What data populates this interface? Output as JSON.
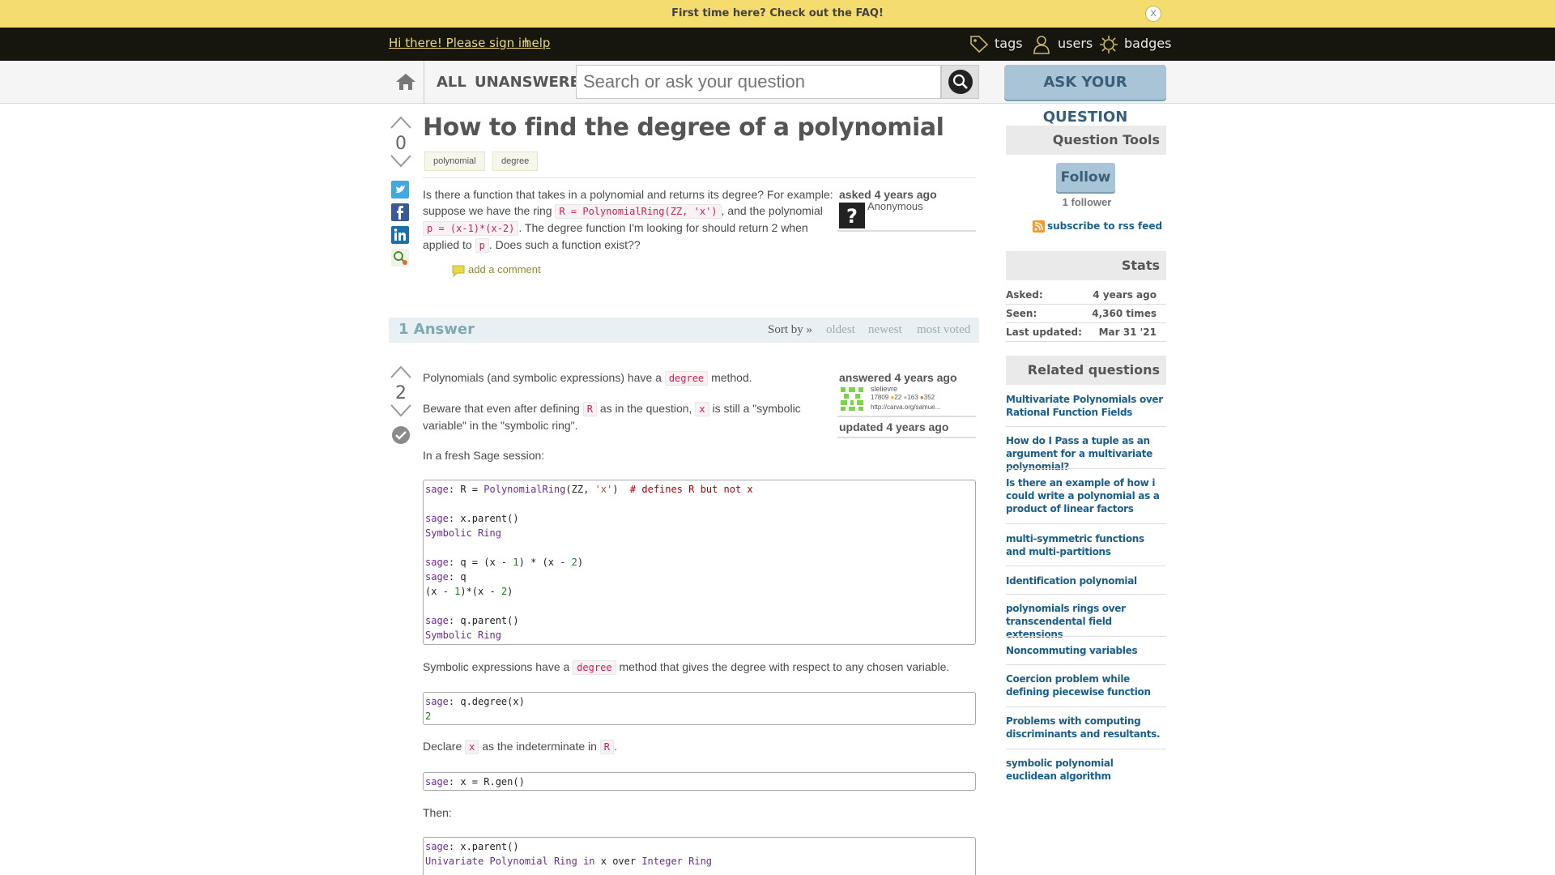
{
  "notify": {
    "message": "First time here? Check out the FAQ!",
    "close": "X"
  },
  "header": {
    "signin": "Hi there! Please sign in",
    "help": "help",
    "nav": [
      {
        "label": "tags",
        "icon": "tag-icon"
      },
      {
        "label": "users",
        "icon": "user-icon"
      },
      {
        "label": "badges",
        "icon": "badge-icon"
      }
    ]
  },
  "secbar": {
    "scope_all": "ALL",
    "scope_unanswered": "UNANSWERED",
    "search_placeholder": "Search or ask your question",
    "ask_button": "ASK YOUR QUESTION"
  },
  "question": {
    "title": "How to find the degree of a polynomial",
    "votes": "0",
    "tags": [
      "polynomial",
      "degree"
    ],
    "text1": "Is there a function that takes in a polynomial and returns its degree? For example: suppose we have the ring",
    "code1": "R = PolynomialRing(ZZ, 'x')",
    "text2": ", and the polynomial",
    "code2": "p = (x-1)*(x-2)",
    "text3": ". The degree function I'm looking for should return 2 when applied to",
    "code3": "p",
    "text4": ". Does such a function exist??",
    "asked": "asked 4 years ago",
    "author": "Anonymous",
    "add_comment": "add a comment"
  },
  "answers": {
    "count": "1 Answer",
    "sort_by": "Sort by »",
    "sort_oldest": "oldest",
    "sort_newest": "newest",
    "sort_most_voted": "most voted"
  },
  "answer": {
    "votes": "2",
    "answered": "answered 4 years ago",
    "user": "slelievre",
    "karma": "17809",
    "badge1": "22",
    "badge2": "163",
    "badge3": "352",
    "url": "http://carva.org/samue...",
    "updated": "updated 4 years ago",
    "p1a": "Polynomials (and symbolic expressions) have a",
    "p1code": "degree",
    "p1b": "method.",
    "p2a": "Beware that even after defining",
    "p2code1": "R",
    "p2b": "as in the question,",
    "p2code2": "x",
    "p2c": "is still a \"symbolic variable\" in the \"symbolic ring\".",
    "p3": "In a fresh Sage session:",
    "p4a": "Symbolic expressions have a",
    "p4code": "degree",
    "p4b": "method that gives the degree with respect to any chosen variable.",
    "p5a": "Declare",
    "p5code1": "x",
    "p5b": "as the indeterminate in",
    "p5code2": "R",
    "p5c": ".",
    "p6": "Then:"
  },
  "sidebar": {
    "tools_title": "Question Tools",
    "follow": "Follow",
    "followers": "1 follower",
    "rss": "subscribe to rss feed",
    "stats_title": "Stats",
    "stats": [
      {
        "label": "Asked:",
        "value": "4 years ago"
      },
      {
        "label": "Seen:",
        "value": "4,360 times"
      },
      {
        "label": "Last updated:",
        "value": "Mar 31 '21"
      }
    ],
    "related_title": "Related questions",
    "related": [
      "Multivariate Polynomials over Rational Function Fields",
      "How do I Pass a tuple as an argument for a multivariate polynomial?",
      "Is there an example of how i could write a polynomial as a product of linear factors",
      "multi-symmetric functions and multi-partitions",
      "Identification polynomial",
      "polynomials rings over transcendental field extensions",
      "Noncommuting variables",
      "Coercion problem while defining piecewise function",
      "Problems with computing discriminants and resultants.",
      "symbolic polynomial euclidean algorithm"
    ]
  },
  "colors": {
    "accent": "#1a5f8c",
    "header_bg": "#16160f",
    "notify_bg": "#f5dc6e",
    "button": "#a8c4d6"
  }
}
